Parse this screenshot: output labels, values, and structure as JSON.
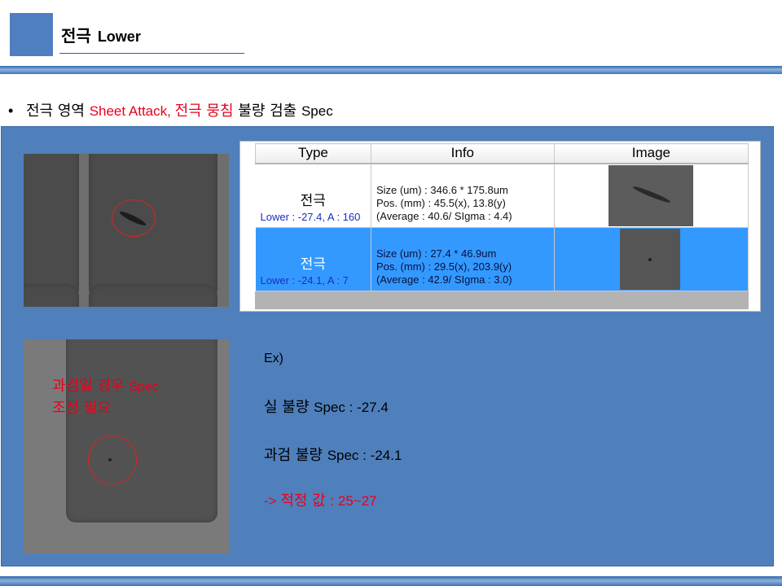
{
  "header": {
    "title": "전극",
    "subtitle": "Lower"
  },
  "bullet": {
    "symbol": "•",
    "part1": "전극 영역 ",
    "part2_red_en": "Sheet Attack, ",
    "part3_red_ko": "전극 뭉침",
    "part4": " 불량 검출 ",
    "part5_en": "Spec"
  },
  "table": {
    "headers": [
      "Type",
      "Info",
      "Image"
    ],
    "rows": [
      {
        "type": "전극",
        "sub": "Lower : -27.4, A : 160",
        "info": [
          "Size (um) : 346.6 * 175.8um",
          "Pos. (mm) : 45.5(x), 13.8(y)",
          "(Average : 40.6/ SIgma : 4.4)"
        ],
        "selected": false
      },
      {
        "type": "전극",
        "sub": "Lower : -24.1, A : 7",
        "info": [
          "Size (um) : 27.4 * 46.9um",
          "Pos. (mm) : 29.5(x), 203.9(y)",
          "(Average : 42.9/ SIgma : 3.0)"
        ],
        "selected": true
      }
    ]
  },
  "image_note": {
    "line1_ko": "과검일 경우 ",
    "line1_en": "Spec",
    "line2": "조정 필요"
  },
  "example": {
    "label": "Ex)",
    "real_ko": "실 불량 ",
    "real_val": "Spec : -27.4",
    "over_ko": "과검 불량 ",
    "over_val": "Spec : -24.1",
    "opt_pre": "-> ",
    "opt_ko": "적정 값 ",
    "opt_val": ": 25~27"
  },
  "colors": {
    "accent_blue": "#4f80bc",
    "selection_blue": "#3399ff",
    "highlight_red": "#e8001c"
  }
}
